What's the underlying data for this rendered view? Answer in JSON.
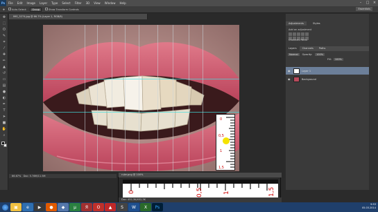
{
  "menubar": {
    "logo": "Ps",
    "items": [
      "File",
      "Edit",
      "Image",
      "Layer",
      "Type",
      "Select",
      "Filter",
      "3D",
      "View",
      "Window",
      "Help"
    ],
    "controls": [
      "–",
      "□",
      "×"
    ]
  },
  "options_bar": {
    "auto_select_label": "Auto-Select:",
    "auto_select_value": "Group",
    "transform_label": "Show Transform Controls",
    "workspace": "Essentials"
  },
  "document": {
    "tab_title": "IMG_5274.jpg @ 66.7% (Layer 1, RGB/8)",
    "status_zoom": "66.67%",
    "status_doc": "Doc: 5.76M/11.5M"
  },
  "panels": {
    "tabs": [
      "Adjustments",
      "Styles"
    ],
    "adjustments_title": "Add an adjustment",
    "mid_tabs": [
      "Channels",
      "Paths"
    ],
    "layers_tabs": [
      "Layers",
      "Channels",
      "Paths"
    ],
    "blend_mode": "Normal",
    "opacity_label": "Opacity:",
    "opacity_value": "100%",
    "fill_label": "Fill:",
    "fill_value": "100%",
    "layers": [
      {
        "name": "Layer 1",
        "selected": true
      },
      {
        "name": "Background",
        "selected": false
      }
    ]
  },
  "ruler_window": {
    "tab_title": "ruler.png @ 100%",
    "labels": [
      "0",
      "0,5",
      "1",
      "1,5"
    ],
    "status": "Doc: 452,3K/452,3K"
  },
  "small_ruler": {
    "labels": [
      "0",
      "0,5",
      "1",
      "1,5"
    ]
  },
  "taskbar": {
    "time": "9:53",
    "date": "05.03.2014"
  },
  "colors": {
    "guide": "#3ee0e0",
    "layer_selected": "#6c7f99",
    "taskbar": "#1f3f6b"
  }
}
